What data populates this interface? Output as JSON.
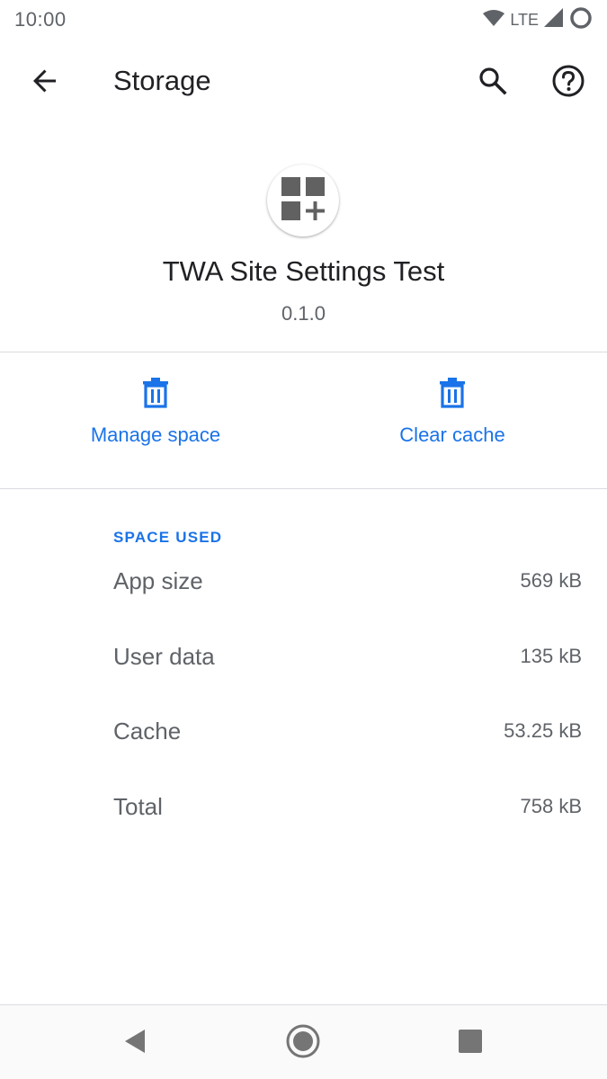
{
  "status_bar": {
    "time": "10:00",
    "network": "LTE"
  },
  "app_bar": {
    "title": "Storage"
  },
  "app_info": {
    "name": "TWA Site Settings Test",
    "version": "0.1.0"
  },
  "actions": {
    "manage_space": "Manage space",
    "clear_cache": "Clear cache"
  },
  "space_used": {
    "header": "SPACE USED",
    "rows": [
      {
        "label": "App size",
        "value": "569 kB"
      },
      {
        "label": "User data",
        "value": "135 kB"
      },
      {
        "label": "Cache",
        "value": "53.25 kB"
      },
      {
        "label": "Total",
        "value": "758 kB"
      }
    ]
  },
  "icons": {
    "back": "arrow-back-icon",
    "search": "search-icon",
    "help": "help-circle-icon",
    "app": "apps-grid-plus-icon",
    "trash": "trash-icon"
  },
  "colors": {
    "accent": "#1a73e8",
    "text_primary": "#202124",
    "text_secondary": "#5f6368",
    "divider": "#dadce0"
  }
}
